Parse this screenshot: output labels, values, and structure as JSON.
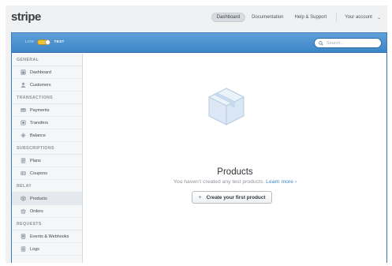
{
  "brand": {
    "logo_text": "stripe"
  },
  "topnav": {
    "items": [
      {
        "label": "Dashboard",
        "active": true
      },
      {
        "label": "Documentation",
        "active": false
      },
      {
        "label": "Help & Support",
        "active": false
      }
    ],
    "account_label": "Your account"
  },
  "mode_toggle": {
    "live_label": "LIVE",
    "test_label": "TEST",
    "mode": "test"
  },
  "search": {
    "placeholder": "Search...",
    "value": ""
  },
  "sidebar": {
    "sections": [
      {
        "title": "GENERAL",
        "items": [
          {
            "label": "Dashboard",
            "icon": "dashboard-icon"
          },
          {
            "label": "Customers",
            "icon": "customers-icon"
          }
        ]
      },
      {
        "title": "TRANSACTIONS",
        "items": [
          {
            "label": "Payments",
            "icon": "payments-icon"
          },
          {
            "label": "Transfers",
            "icon": "transfers-icon"
          },
          {
            "label": "Balance",
            "icon": "balance-icon"
          }
        ]
      },
      {
        "title": "SUBSCRIPTIONS",
        "items": [
          {
            "label": "Plans",
            "icon": "plans-icon"
          },
          {
            "label": "Coupons",
            "icon": "coupons-icon"
          }
        ]
      },
      {
        "title": "RELAY",
        "items": [
          {
            "label": "Products",
            "icon": "products-icon",
            "active": true
          },
          {
            "label": "Orders",
            "icon": "orders-icon"
          }
        ]
      },
      {
        "title": "REQUESTS",
        "items": [
          {
            "label": "Events & Webhooks",
            "icon": "events-icon"
          },
          {
            "label": "Logs",
            "icon": "logs-icon"
          }
        ]
      }
    ]
  },
  "main": {
    "title": "Products",
    "subtitle": "You haven’t created any test products.",
    "learn_more": "Learn more ›",
    "cta_icon": "+",
    "cta_label": "Create your first product"
  },
  "colors": {
    "accent": "#3d86c7",
    "toggle": "#f0c236",
    "sidebar_bg": "#f5f6f8"
  }
}
